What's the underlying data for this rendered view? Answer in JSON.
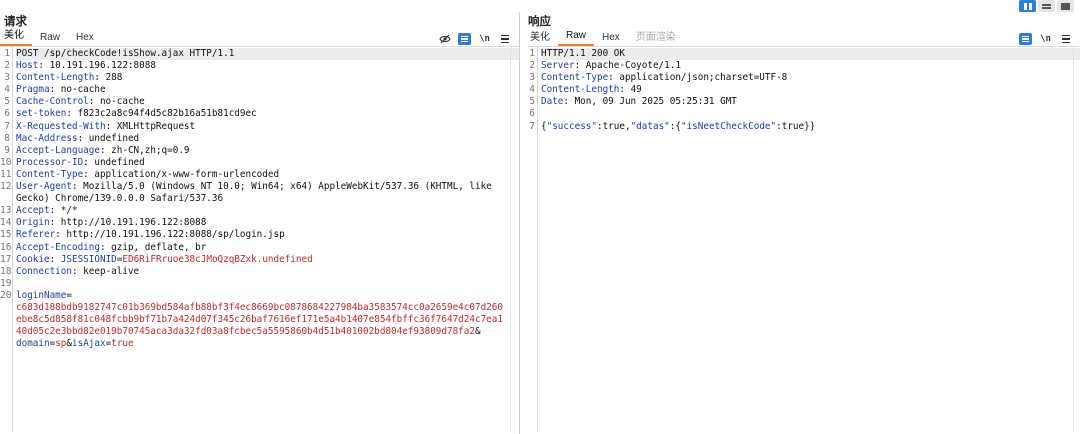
{
  "request": {
    "title": "请求",
    "tabs": [
      "美化",
      "Raw",
      "Hex"
    ],
    "active_tab": 0,
    "icons": [
      "eye-off-icon",
      "wrap-lines-icon",
      "newline-icon",
      "menu-icon"
    ],
    "newline_label": "\\n",
    "lines": [
      {
        "n": "1",
        "segs": [
          {
            "t": "POST /sp/checkCode!isShow.ajax HTTP/1.1",
            "c": "v"
          }
        ]
      },
      {
        "n": "2",
        "segs": [
          {
            "t": "Host",
            "c": "k"
          },
          {
            "t": ": 10.191.196.122:8088",
            "c": "v"
          }
        ]
      },
      {
        "n": "3",
        "segs": [
          {
            "t": "Content-Length",
            "c": "k"
          },
          {
            "t": ": 288",
            "c": "v"
          }
        ]
      },
      {
        "n": "4",
        "segs": [
          {
            "t": "Pragma",
            "c": "k"
          },
          {
            "t": ": no-cache",
            "c": "v"
          }
        ]
      },
      {
        "n": "5",
        "segs": [
          {
            "t": "Cache-Control",
            "c": "k"
          },
          {
            "t": ": no-cache",
            "c": "v"
          }
        ]
      },
      {
        "n": "6",
        "segs": [
          {
            "t": "set-token",
            "c": "k"
          },
          {
            "t": ": f823c2a8c94f4d5c82b16a51b81cd9ec",
            "c": "v"
          }
        ]
      },
      {
        "n": "7",
        "segs": [
          {
            "t": "X-Requested-With",
            "c": "k"
          },
          {
            "t": ": XMLHttpRequest",
            "c": "v"
          }
        ]
      },
      {
        "n": "8",
        "segs": [
          {
            "t": "Mac-Address",
            "c": "k"
          },
          {
            "t": ": undefined",
            "c": "v"
          }
        ]
      },
      {
        "n": "9",
        "segs": [
          {
            "t": "Accept-Language",
            "c": "k"
          },
          {
            "t": ": zh-CN,zh;q=0.9",
            "c": "v"
          }
        ]
      },
      {
        "n": "10",
        "segs": [
          {
            "t": "Processor-ID",
            "c": "k"
          },
          {
            "t": ": undefined",
            "c": "v"
          }
        ]
      },
      {
        "n": "11",
        "segs": [
          {
            "t": "Content-Type",
            "c": "k"
          },
          {
            "t": ": application/x-www-form-urlencoded",
            "c": "v"
          }
        ]
      },
      {
        "n": "12",
        "segs": [
          {
            "t": "User-Agent",
            "c": "k"
          },
          {
            "t": ": Mozilla/5.0 (Windows NT 10.0; Win64; x64) AppleWebKit/537.36 (KHTML, like",
            "c": "v"
          }
        ]
      },
      {
        "n": "",
        "segs": [
          {
            "t": "Gecko) Chrome/139.0.0.0 Safari/537.36",
            "c": "v"
          }
        ]
      },
      {
        "n": "13",
        "segs": [
          {
            "t": "Accept",
            "c": "k"
          },
          {
            "t": ": */*",
            "c": "v"
          }
        ]
      },
      {
        "n": "14",
        "segs": [
          {
            "t": "Origin",
            "c": "k"
          },
          {
            "t": ": http://10.191.196.122:8088",
            "c": "v"
          }
        ]
      },
      {
        "n": "15",
        "segs": [
          {
            "t": "Referer",
            "c": "k"
          },
          {
            "t": ": http://10.191.196.122:8088/sp/login.jsp",
            "c": "v"
          }
        ]
      },
      {
        "n": "16",
        "segs": [
          {
            "t": "Accept-Encoding",
            "c": "k"
          },
          {
            "t": ": gzip, deflate, br",
            "c": "v"
          }
        ]
      },
      {
        "n": "17",
        "segs": [
          {
            "t": "Cookie",
            "c": "k"
          },
          {
            "t": ": ",
            "c": "v"
          },
          {
            "t": "JSESSIONID",
            "c": "k"
          },
          {
            "t": "=",
            "c": "v"
          },
          {
            "t": "ED6RiFRruoe38cJMoQzqBZxk.undefined",
            "c": "red"
          }
        ]
      },
      {
        "n": "18",
        "segs": [
          {
            "t": "Connection",
            "c": "k"
          },
          {
            "t": ": keep-alive",
            "c": "v"
          }
        ]
      },
      {
        "n": "19",
        "segs": []
      },
      {
        "n": "20",
        "segs": [
          {
            "t": "loginName",
            "c": "k"
          },
          {
            "t": "=",
            "c": "v"
          }
        ]
      },
      {
        "n": "",
        "segs": [
          {
            "t": "c683d188bdb9182747c01b369bd584afb88bf3f4ec8669bc0878684227984ba3583574cc0a2659e4c07d260",
            "c": "red"
          }
        ]
      },
      {
        "n": "",
        "segs": [
          {
            "t": "ebe8c5d858f81c048fcbb9bf71b7a424d07f345c26baf7616ef171e5a4b1407e854fbffc36f7647d24c7ea1",
            "c": "red"
          }
        ]
      },
      {
        "n": "",
        "segs": [
          {
            "t": "40d05c2e3bbd82e019b70745aca3da32fd03a8fcbec5a5595860b4d51b401002bd804ef93809d78fa2",
            "c": "red"
          },
          {
            "t": "&",
            "c": "v"
          }
        ]
      },
      {
        "n": "",
        "segs": [
          {
            "t": "domain",
            "c": "k"
          },
          {
            "t": "=",
            "c": "v"
          },
          {
            "t": "sp",
            "c": "red"
          },
          {
            "t": "&",
            "c": "v"
          },
          {
            "t": "isAjax",
            "c": "k"
          },
          {
            "t": "=",
            "c": "v"
          },
          {
            "t": "true",
            "c": "red"
          }
        ]
      }
    ]
  },
  "response": {
    "title": "响应",
    "tabs": [
      "美化",
      "Raw",
      "Hex",
      "页面渲染"
    ],
    "active_tab": 1,
    "icons": [
      "wrap-lines-icon",
      "newline-icon",
      "menu-icon"
    ],
    "newline_label": "\\n",
    "lines": [
      {
        "n": "1",
        "segs": [
          {
            "t": "HTTP/1.1 200 OK",
            "c": "v"
          }
        ]
      },
      {
        "n": "2",
        "segs": [
          {
            "t": "Server",
            "c": "k"
          },
          {
            "t": ": Apache-Coyote/1.1",
            "c": "v"
          }
        ]
      },
      {
        "n": "3",
        "segs": [
          {
            "t": "Content-Type",
            "c": "k"
          },
          {
            "t": ": application/json;charset=UTF-8",
            "c": "v"
          }
        ]
      },
      {
        "n": "4",
        "segs": [
          {
            "t": "Content-Length",
            "c": "k"
          },
          {
            "t": ": 49",
            "c": "v"
          }
        ]
      },
      {
        "n": "5",
        "segs": [
          {
            "t": "Date",
            "c": "k"
          },
          {
            "t": ": Mon, 09 Jun 2025 05:25:31 GMT",
            "c": "v"
          }
        ]
      },
      {
        "n": "6",
        "segs": []
      },
      {
        "n": "7",
        "segs": [
          {
            "t": "{",
            "c": "v"
          },
          {
            "t": "\"success\"",
            "c": "k"
          },
          {
            "t": ":true,",
            "c": "v"
          },
          {
            "t": "\"datas\"",
            "c": "k"
          },
          {
            "t": ":{",
            "c": "v"
          },
          {
            "t": "\"isNeetCheckCode\"",
            "c": "k"
          },
          {
            "t": ":true}}",
            "c": "v"
          }
        ]
      }
    ]
  },
  "colors": {
    "accent": "#2f7be0",
    "tab_underline": "#e8822c",
    "key": "#1f3ea8",
    "value_red": "#c4282d"
  }
}
